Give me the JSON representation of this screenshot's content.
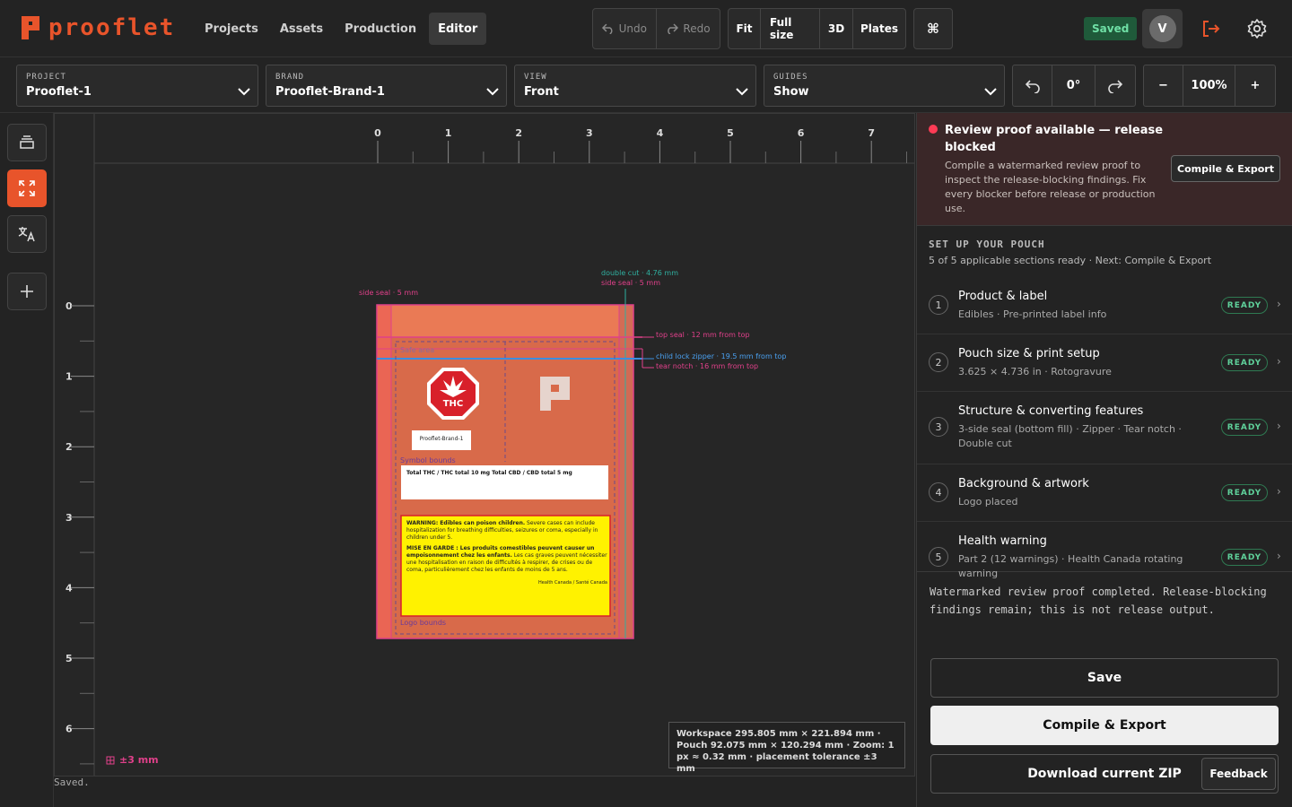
{
  "app": {
    "name": "prooflet"
  },
  "nav": {
    "items": [
      "Projects",
      "Assets",
      "Production",
      "Editor"
    ],
    "active": "Editor"
  },
  "history": {
    "undo": "Undo",
    "redo": "Redo"
  },
  "view_buttons": {
    "fit": "Fit",
    "full_size": "Full size",
    "three_d": "3D",
    "plates": "Plates",
    "command": "⌘"
  },
  "status_badge": "Saved",
  "user": {
    "initial": "V"
  },
  "toolbar": {
    "project": {
      "label": "PROJECT",
      "value": "Prooflet-1"
    },
    "brand": {
      "label": "BRAND",
      "value": "Prooflet-Brand-1"
    },
    "view": {
      "label": "VIEW",
      "value": "Front"
    },
    "guides": {
      "label": "GUIDES",
      "value": "Show"
    },
    "rotation": "0°",
    "zoom": {
      "minus": "−",
      "value": "100%",
      "plus": "+"
    }
  },
  "ruler": {
    "top": [
      "0",
      "1",
      "2",
      "3",
      "4",
      "5",
      "6",
      "7"
    ],
    "left": [
      "0",
      "1",
      "2",
      "3",
      "4",
      "5",
      "6"
    ]
  },
  "pouch": {
    "annotations": {
      "side_seal_left": "side seal · 5 mm",
      "double_cut": "double cut · 4.76 mm",
      "side_seal_right": "side seal · 5 mm",
      "top_seal": "top seal · 12 mm from top",
      "zipper": "child lock zipper · 19.5 mm from top",
      "tear_notch": "tear notch · 16 mm from top"
    },
    "safe_area": "Safe area",
    "symbol_bounds": "Symbol bounds",
    "logo_bounds": "Logo bounds",
    "thc_symbol": "THC",
    "brand_label": "Prooflet-Brand-1",
    "potency": "Total THC / THC total 10 mg Total CBD / CBD total 5 mg",
    "warning_en_bold": "WARNING: Edibles can poison children.",
    "warning_en": " Severe cases can include hospitalization for breathing difficulties, seizures or coma, especially in children under 5.",
    "warning_fr_bold": "MISE EN GARDE : Les produits comestibles peuvent causer un empoisonnement chez les enfants.",
    "warning_fr": " Les cas graves peuvent nécessiter une hospitalisation en raison de difficultés à respirer, de crises ou de coma, particulièrement chez les enfants de moins de 5 ans.",
    "warning_source": "Health Canada / Santé Canada"
  },
  "canvas": {
    "tolerance": "±3 mm",
    "info": "Workspace 295.805 mm × 221.894 mm · Pouch 92.075 mm × 120.294 mm · Zoom: 1 px ≈ 0.32 mm · placement tolerance ±3 mm"
  },
  "status_line": "Saved.",
  "alert": {
    "title": "Review proof available — release blocked",
    "body": "Compile a watermarked review proof to inspect the release-blocking findings. Fix every blocker before release or production use.",
    "button": "Compile & Export"
  },
  "setup": {
    "heading": "SET UP YOUR POUCH",
    "subheading": "5 of 5 applicable sections ready · Next: Compile & Export",
    "steps": [
      {
        "num": "1",
        "title": "Product & label",
        "desc": "Edibles · Pre-printed label info",
        "status": "READY"
      },
      {
        "num": "2",
        "title": "Pouch size & print setup",
        "desc": "3.625 × 4.736 in · Rotogravure",
        "status": "READY"
      },
      {
        "num": "3",
        "title": "Structure & converting features",
        "desc": "3-side seal (bottom fill) · Zipper · Tear notch · Double cut",
        "status": "READY"
      },
      {
        "num": "4",
        "title": "Background & artwork",
        "desc": "Logo placed",
        "status": "READY"
      },
      {
        "num": "5",
        "title": "Health warning",
        "desc": "Part 2 (12 warnings) · Health Canada rotating warning",
        "status": "READY"
      }
    ]
  },
  "log": "Watermarked review proof completed. Release-blocking findings remain; this is not release output.",
  "actions": {
    "save": "Save",
    "compile": "Compile & Export",
    "download": "Download current ZIP",
    "feedback": "Feedback"
  },
  "colors": {
    "accent": "#e8542b",
    "ready": "#5fd09a",
    "alert": "#ff3b55",
    "guide_pink": "#e0408a",
    "guide_blue": "#3a8ee0",
    "warning_yellow": "#fff200"
  }
}
